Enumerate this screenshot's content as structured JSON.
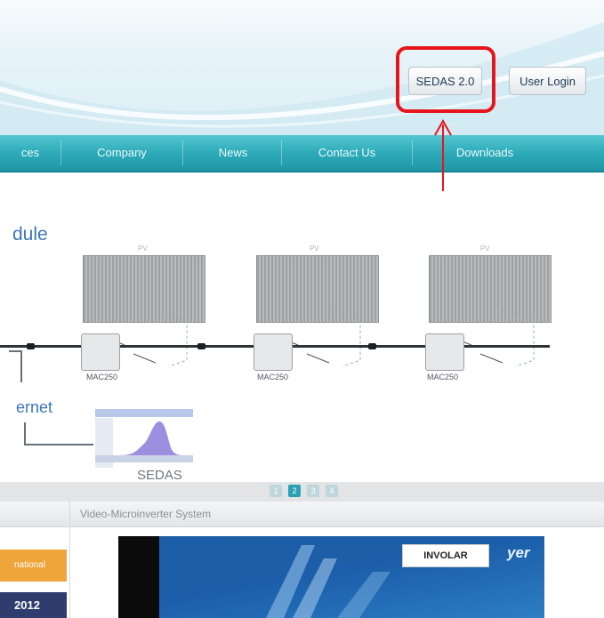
{
  "header": {
    "sedas_button": "SEDAS 2.0",
    "login_button": "User Login"
  },
  "nav": {
    "items": [
      "ces",
      "Company",
      "News",
      "Contact Us",
      "Downloads"
    ]
  },
  "content": {
    "title": "dule",
    "panel_label": "PV",
    "device_label": "MAC250",
    "internet_label": "ernet",
    "sedas_label": "SEDAS",
    "mini_logo": "INVOLAR"
  },
  "pager": {
    "pages": [
      "1",
      "2",
      "3",
      "4"
    ],
    "active": "2"
  },
  "bottom": {
    "video_tab": "Video-Microinverter System",
    "badge1": "national",
    "badge2": "2012",
    "video_logo": "INVOLAR",
    "video_overlay": "yer"
  },
  "colors": {
    "nav": "#2eaab8",
    "highlight": "#e8141c",
    "title": "#3a76b8",
    "badge_orange": "#f0a53a",
    "badge_navy": "#2f3c6e"
  }
}
